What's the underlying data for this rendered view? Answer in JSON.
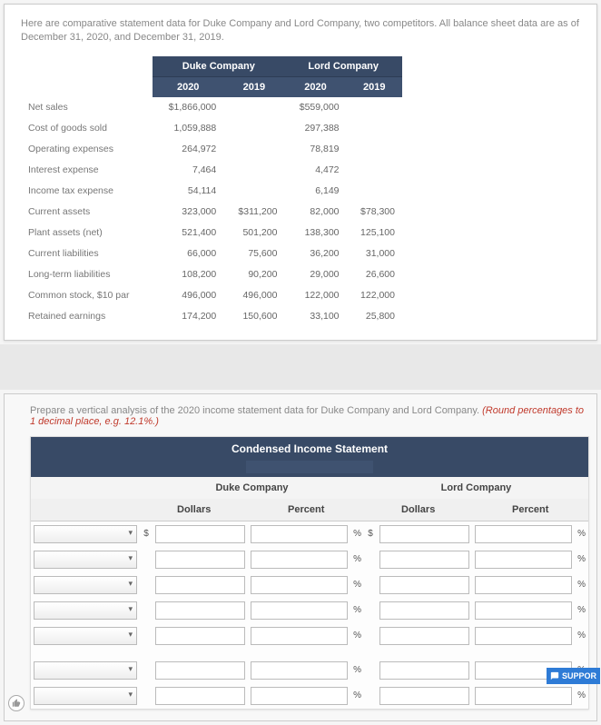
{
  "intro": "Here are comparative statement data for Duke Company and Lord Company, two competitors. All balance sheet data are as of December 31, 2020, and December 31, 2019.",
  "companies": {
    "duke": "Duke Company",
    "lord": "Lord Company"
  },
  "years": {
    "y2020": "2020",
    "y2019": "2019"
  },
  "rows": [
    {
      "label": "Net sales",
      "d20": "$1,866,000",
      "d19": "",
      "l20": "$559,000",
      "l19": ""
    },
    {
      "label": "Cost of goods sold",
      "d20": "1,059,888",
      "d19": "",
      "l20": "297,388",
      "l19": ""
    },
    {
      "label": "Operating expenses",
      "d20": "264,972",
      "d19": "",
      "l20": "78,819",
      "l19": ""
    },
    {
      "label": "Interest expense",
      "d20": "7,464",
      "d19": "",
      "l20": "4,472",
      "l19": ""
    },
    {
      "label": "Income tax expense",
      "d20": "54,114",
      "d19": "",
      "l20": "6,149",
      "l19": ""
    },
    {
      "label": "Current assets",
      "d20": "323,000",
      "d19": "$311,200",
      "l20": "82,000",
      "l19": "$78,300"
    },
    {
      "label": "Plant assets (net)",
      "d20": "521,400",
      "d19": "501,200",
      "l20": "138,300",
      "l19": "125,100"
    },
    {
      "label": "Current liabilities",
      "d20": "66,000",
      "d19": "75,600",
      "l20": "36,200",
      "l19": "31,000"
    },
    {
      "label": "Long-term liabilities",
      "d20": "108,200",
      "d19": "90,200",
      "l20": "29,000",
      "l19": "26,600"
    },
    {
      "label": "Common stock, $10 par",
      "d20": "496,000",
      "d19": "496,000",
      "l20": "122,000",
      "l19": "122,000"
    },
    {
      "label": "Retained earnings",
      "d20": "174,200",
      "d19": "150,600",
      "l20": "33,100",
      "l19": "25,800"
    }
  ],
  "instruction_a": "Prepare a vertical analysis of the 2020 income statement data for Duke Company and Lord Company. ",
  "instruction_b": "(Round percentages to 1 decimal place, e.g. 12.1%.)",
  "cis_title": "Condensed Income Statement",
  "headers": {
    "dollars": "Dollars",
    "percent": "Percent"
  },
  "sym": {
    "dollar": "$",
    "percent": "%"
  },
  "support": "SUPPOR"
}
